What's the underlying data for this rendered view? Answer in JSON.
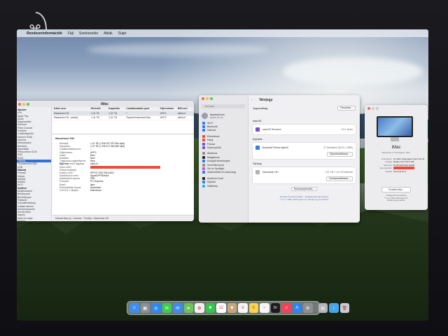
{
  "menubar": {
    "app": "Rendszerinformációk",
    "items": [
      "Fájl",
      "Szerkesztés",
      "Ablak",
      "Súgó"
    ]
  },
  "sysinfo": {
    "title": "iMac",
    "sidebar": [
      {
        "label": "Hardver",
        "hdr": true
      },
      {
        "label": "ATA"
      },
      {
        "label": "Apple Pay"
      },
      {
        "label": "Audio"
      },
      {
        "label": "Diagnosztika"
      },
      {
        "label": "Ethernet"
      },
      {
        "label": "Fibre Channel"
      },
      {
        "label": "FireWire"
      },
      {
        "label": "Grafika/kijelzők"
      },
      {
        "label": "Hardver RAID"
      },
      {
        "label": "Kamera"
      },
      {
        "label": "Kártyaolvasó"
      },
      {
        "label": "Memória"
      },
      {
        "label": "Nyomtatók"
      },
      {
        "label": "Párhuzamos SCSI"
      },
      {
        "label": "SAS"
      },
      {
        "label": "SATA"
      },
      {
        "label": "Tárhely",
        "sel": true
      },
      {
        "label": "Thunderbolt/USB4"
      },
      {
        "label": "USB"
      },
      {
        "label": "Hálózat",
        "hdr": true
      },
      {
        "label": "Firewall"
      },
      {
        "label": "Helyek"
      },
      {
        "label": "Kötetek"
      },
      {
        "label": "WWAN"
      },
      {
        "label": "Wi-Fi"
      },
      {
        "label": "Szoftver",
        "hdr": true
      },
      {
        "label": "Alkalmazások"
      },
      {
        "label": "Betűtípusok"
      },
      {
        "label": "Bővítmények"
      },
      {
        "label": "Fejlesztő"
      },
      {
        "label": "Hozzáférhetőség"
      },
      {
        "label": "Indítási elemek"
      },
      {
        "label": "Keretrendszerek"
      },
      {
        "label": "Kezelt kliens"
      },
      {
        "label": "Naplók"
      },
      {
        "label": "Nyelv és régió"
      },
      {
        "label": "Profilok"
      }
    ],
    "columns": [
      "Kötet neve",
      "Elérhető",
      "Kapacitás",
      "Csatlakoztatási pont",
      "Fájlrendszer",
      "BSD-név"
    ],
    "rows": [
      [
        "Macintosh HD",
        "1,01 TB",
        "1,01 TB",
        "/",
        "APFS",
        "disk1s1"
      ],
      [
        "Macintosh HD - adatok",
        "1,01 TB",
        "1,01 TB",
        "/System/Volumes/Data",
        "APFS",
        "disk1s2"
      ]
    ],
    "detail_title": "Macintosh HD:",
    "detail": [
      {
        "k": "Elérhető:",
        "v": "1,01 TB (1 006 337 007 864 byte)"
      },
      {
        "k": "Kapacitás:",
        "v": "1,01 TB (1 008 417 684 880 byte)"
      },
      {
        "k": "Csatlakoztatási pont:",
        "v": "/"
      },
      {
        "k": "Fájlrendszer:",
        "v": "APFS"
      },
      {
        "k": "Írható:",
        "v": "Nem"
      },
      {
        "k": "Kiadható:",
        "v": "Nem"
      },
      {
        "k": "Tulajdonos engedélyének figyelmen kívül hagyása:",
        "v": "Nem"
      },
      {
        "k": "BSD-név:",
        "v": "disk1s1"
      },
      {
        "k": "Kötet UUID:",
        "v": "",
        "redact": true
      },
      {
        "k": "Fizikai meghajtó:",
        "v": ""
      },
      {
        "k": "Eszköz neve:",
        "v": "APPLE SSD SM1024G"
      },
      {
        "k": "Adathordozó neve:",
        "v": "AppleAPFSMedia"
      },
      {
        "k": "Adathordozó típusa:",
        "v": "SSD"
      },
      {
        "k": "Protokoll:",
        "v": "PCI-Express"
      },
      {
        "k": "Belső:",
        "v": "Igen"
      },
      {
        "k": "Partíciótérkép típusa:",
        "v": "Ismeretlen"
      },
      {
        "k": "S.M.A.R.T. állapot:",
        "v": "Ellenőrizve"
      }
    ],
    "pathbar": "Kalmár iMac-je › Hardver › Tárhely › Macintosh HD"
  },
  "settings": {
    "search": "Keresés",
    "account_name": "Bejelentkezés",
    "account_sub": "Apple ID-val",
    "items": [
      {
        "label": "Wi-Fi",
        "color": "#2f7bf5"
      },
      {
        "label": "Bluetooth",
        "color": "#2f7bf5"
      },
      {
        "label": "Hálózat",
        "color": "#2f7bf5"
      },
      {
        "gap": true
      },
      {
        "label": "Értesítések",
        "color": "#ee4b3e"
      },
      {
        "label": "Hang",
        "color": "#ee4b3e"
      },
      {
        "label": "Fókusz",
        "color": "#6b53d6"
      },
      {
        "label": "Képernyőidő",
        "color": "#6b53d6"
      },
      {
        "gap": true
      },
      {
        "label": "Általános",
        "color": "#8e8e93"
      },
      {
        "label": "Megjelenés",
        "color": "#222222"
      },
      {
        "label": "Kisegítő lehetőségek",
        "color": "#2f7bf5"
      },
      {
        "label": "Vezérlőközpont",
        "color": "#8e8e93"
      },
      {
        "label": "Siri és Spotlight",
        "color": "#c455e0"
      },
      {
        "label": "Adatvédelem és biztonság",
        "color": "#2f7bf5"
      },
      {
        "gap": true
      },
      {
        "label": "Asztal és Dock",
        "color": "#222222"
      },
      {
        "label": "Kijelzők",
        "color": "#2f7bf5"
      },
      {
        "label": "Háttérkép",
        "color": "#38aaf0"
      }
    ],
    "title": "Névjegy",
    "sec_support": "Jogosultság",
    "details_btn": "Részletek...",
    "sec_macos": "macOS",
    "macos_name": "macOS Sonoma",
    "macos_ver": "14.0 verzió",
    "sec_display": "Kijelzők",
    "display_name": "Beépített Retina kijelző",
    "display_spec": "27 hüvelykes (5120 × 2880)",
    "display_btn": "Kijelzőbeállítások...",
    "sec_storage": "Tárhely",
    "storage_name": "Macintosh HD",
    "storage_spec": "1,01 TB / 1,01 TB elérhető",
    "storage_btn": "Tárhelybeállítások...",
    "sysreport_btn": "Rendszerjelentés...",
    "legal": "Szoftver licencszerződés · Szabályozási tanúsítvány",
    "copyright": "™ és © 1983–2023 Apple Inc. Minden jog fenntartva."
  },
  "about": {
    "name": "iMac",
    "sub": "Retina 5K, 27 hüvelykes, 2017",
    "specs": [
      {
        "k": "Processzor",
        "v": "3,4 GHz négymagos Intel Core i5"
      },
      {
        "k": "Grafika",
        "v": "Radeon Pro 570 4 GB"
      },
      {
        "k": "Memória",
        "v": "8 GB 2400 MHz DDR4"
      },
      {
        "k": "Sorozatszám",
        "v": "",
        "redact": true
      },
      {
        "k": "macOS",
        "v": "Sonoma 14.0"
      }
    ],
    "more_btn": "További infók...",
    "legal": "Szabályozási tanúsítvány\n™ és © 1983–2023 Apple Inc.\nMinden jog fenntartva."
  },
  "dock": {
    "icons": [
      {
        "name": "finder-icon",
        "color": "#3d8ef0",
        "glyph": "☺"
      },
      {
        "name": "launchpad-icon",
        "color": "#8a8f99",
        "glyph": "▦"
      },
      {
        "name": "safari-icon",
        "color": "#2d8bf0",
        "glyph": "◎"
      },
      {
        "name": "messages-icon",
        "color": "#3ccf4e",
        "glyph": "✉"
      },
      {
        "name": "mail-icon",
        "color": "#3c8cf2",
        "glyph": "✉"
      },
      {
        "name": "maps-icon",
        "color": "#6cc35a",
        "glyph": "➤"
      },
      {
        "name": "photos-icon",
        "color": "#f0f0f0",
        "glyph": "✿"
      },
      {
        "name": "facetime-icon",
        "color": "#37c44c",
        "glyph": "■"
      },
      {
        "name": "calendar-icon",
        "color": "#ffffff",
        "glyph": "12"
      },
      {
        "name": "contacts-icon",
        "color": "#c9a57a",
        "glyph": "☻"
      },
      {
        "name": "reminders-icon",
        "color": "#f5f5f5",
        "glyph": "≡"
      },
      {
        "name": "notes-icon",
        "color": "#f7d44a",
        "glyph": "≡"
      },
      {
        "name": "freeform-icon",
        "color": "#f5f5f5",
        "glyph": "~"
      },
      {
        "name": "tv-icon",
        "color": "#1c1c1e",
        "glyph": "tv"
      },
      {
        "name": "music-icon",
        "color": "#f0435a",
        "glyph": "♫"
      },
      {
        "name": "app-store-icon",
        "color": "#2f84f3",
        "glyph": "A"
      },
      {
        "name": "system-settings-icon",
        "color": "#8e8e93",
        "glyph": "⚙"
      },
      {
        "sep": true
      },
      {
        "name": "system-info-icon",
        "color": "#b5b5ba",
        "glyph": "▤"
      },
      {
        "name": "downloads-icon",
        "color": "#4aa3e6",
        "glyph": "↓"
      },
      {
        "name": "trash-icon",
        "color": "#c9ced6",
        "glyph": "🗑"
      }
    ]
  },
  "colors": {
    "accent": "#2f6fd8",
    "redaction": "#ef4a3c"
  }
}
